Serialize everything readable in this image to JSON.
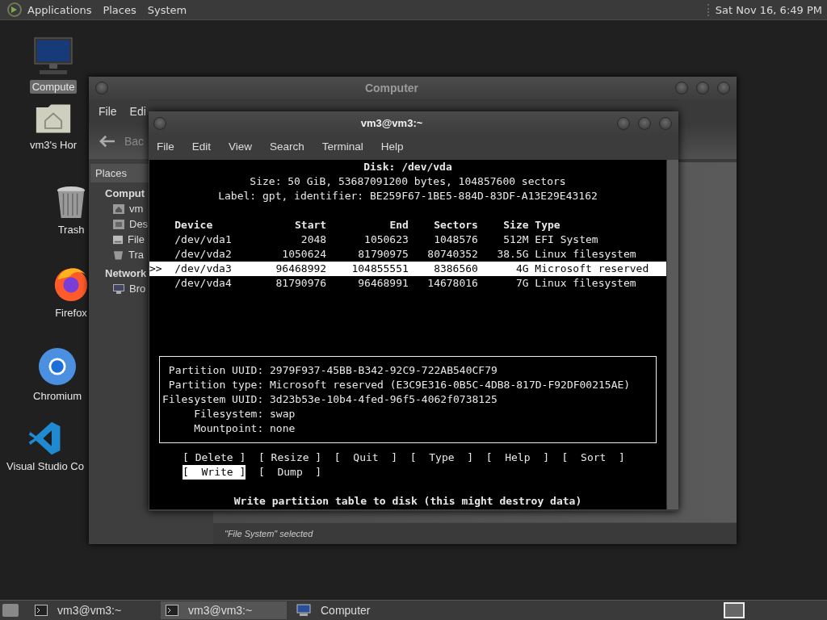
{
  "top_panel": {
    "menus": [
      "Applications",
      "Places",
      "System"
    ],
    "clock": "Sat Nov 16, 6:49 PM"
  },
  "desktop_icons": [
    {
      "kind": "computer",
      "label": "Compute",
      "selected": true
    },
    {
      "kind": "home",
      "label": "vm3's Hor",
      "selected": false
    },
    {
      "kind": "trash",
      "label": "Trash",
      "selected": false
    },
    {
      "kind": "firefox",
      "label": "Firefox",
      "selected": false
    },
    {
      "kind": "chromium",
      "label": "Chromium",
      "selected": false
    },
    {
      "kind": "vscode",
      "label": "Visual Studio Co",
      "selected": false
    }
  ],
  "file_manager": {
    "title": "Computer",
    "menu": [
      "File",
      "Edi"
    ],
    "back_button": "Bac",
    "sidebar": {
      "header": "Places",
      "sections": [
        {
          "label": "Comput",
          "children": [
            {
              "label": "vm",
              "kind": "home"
            },
            {
              "label": "Des",
              "kind": "desktop"
            },
            {
              "label": "File",
              "kind": "drive"
            },
            {
              "label": "Tra",
              "kind": "trash"
            }
          ]
        },
        {
          "label": "Network",
          "children": [
            {
              "label": "Bro",
              "kind": "network"
            }
          ]
        }
      ]
    },
    "status": "\"File System\" selected"
  },
  "terminal": {
    "title": "vm3@vm3:~",
    "menu": [
      "File",
      "Edit",
      "View",
      "Search",
      "Terminal",
      "Help"
    ],
    "disk_lines": [
      "Disk: /dev/vda",
      "Size: 50 GiB, 53687091200 bytes, 104857600 sectors",
      "Label: gpt, identifier: BE259F67-1BE5-884D-83DF-A13E29E43162"
    ],
    "columns": [
      "Device",
      "Start",
      "End",
      "Sectors",
      "Size",
      "Type"
    ],
    "marker": ">>",
    "partitions": [
      {
        "device": "/dev/vda1",
        "start": "2048",
        "end": "1050623",
        "sectors": "1048576",
        "size": "512M",
        "type": "EFI System",
        "selected": false
      },
      {
        "device": "/dev/vda2",
        "start": "1050624",
        "end": "81790975",
        "sectors": "80740352",
        "size": "38.5G",
        "type": "Linux filesystem",
        "selected": false
      },
      {
        "device": "/dev/vda3",
        "start": "96468992",
        "end": "104855551",
        "sectors": "8386560",
        "size": "4G",
        "type": "Microsoft reserved",
        "selected": true
      },
      {
        "device": "/dev/vda4",
        "start": "81790976",
        "end": "96468991",
        "sectors": "14678016",
        "size": "7G",
        "type": "Linux filesystem",
        "selected": false
      }
    ],
    "details": [
      {
        "key": "Partition UUID:",
        "value": "2979F937-45BB-B342-92C9-722AB540CF79"
      },
      {
        "key": "Partition type:",
        "value": "Microsoft reserved (E3C9E316-0B5C-4DB8-817D-F92DF00215AE)"
      },
      {
        "key": "Filesystem UUID:",
        "value": "3d23b53e-10b4-4fed-96f5-4062f0738125"
      },
      {
        "key": "Filesystem:",
        "value": "swap"
      },
      {
        "key": "Mountpoint:",
        "value": "none"
      }
    ],
    "actions": [
      {
        "label": "[ Delete ]",
        "selected": false
      },
      {
        "label": "[ Resize ]",
        "selected": false
      },
      {
        "label": "[  Quit  ]",
        "selected": false
      },
      {
        "label": "[  Type  ]",
        "selected": false
      },
      {
        "label": "[  Help  ]",
        "selected": false
      },
      {
        "label": "[  Sort  ]",
        "selected": false
      },
      {
        "label": "[  Write ]",
        "selected": true
      },
      {
        "label": "[  Dump  ]",
        "selected": false
      }
    ],
    "hint": "Write partition table to disk (this might destroy data)"
  },
  "taskbar": {
    "items": [
      {
        "kind": "terminal",
        "label": "vm3@vm3:~",
        "selected": false
      },
      {
        "kind": "terminal",
        "label": "vm3@vm3:~",
        "selected": true
      },
      {
        "kind": "computer",
        "label": "Computer",
        "selected": false
      }
    ]
  }
}
